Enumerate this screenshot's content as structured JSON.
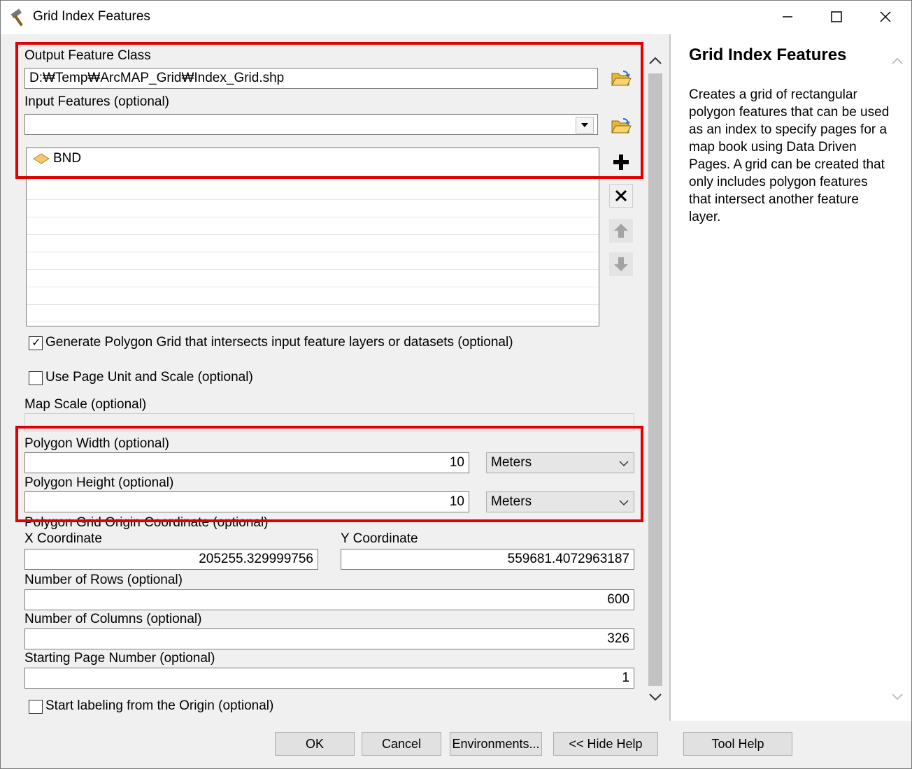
{
  "window": {
    "title": "Grid Index Features",
    "controls": [
      "minimize",
      "maximize",
      "close"
    ]
  },
  "form": {
    "output_feature_class": {
      "label": "Output Feature Class",
      "value": "D:₩Temp₩ArcMAP_Grid₩Index_Grid.shp"
    },
    "input_features": {
      "label": "Input Features (optional)",
      "value": "",
      "items": [
        "BND"
      ]
    },
    "generate_polygon_grid": {
      "label": "Generate Polygon Grid that intersects input feature layers or datasets (optional)",
      "checked": true
    },
    "use_page_unit": {
      "label": "Use Page Unit and Scale (optional)",
      "checked": false
    },
    "map_scale": {
      "label": "Map Scale (optional)",
      "value": ""
    },
    "polygon_width": {
      "label": "Polygon Width (optional)",
      "value": "10",
      "unit": "Meters"
    },
    "polygon_height": {
      "label": "Polygon Height (optional)",
      "value": "10",
      "unit": "Meters"
    },
    "origin": {
      "label": "Polygon Grid Origin Coordinate (optional)",
      "x_label": "X Coordinate",
      "x_value": "205255.329999756",
      "y_label": "Y Coordinate",
      "y_value": "559681.4072963187"
    },
    "rows": {
      "label": "Number of Rows (optional)",
      "value": "600"
    },
    "columns": {
      "label": "Number of Columns (optional)",
      "value": "326"
    },
    "starting_page": {
      "label": "Starting Page Number (optional)",
      "value": "1"
    },
    "start_labeling": {
      "label": "Start labeling from the Origin (optional)",
      "checked": false
    }
  },
  "buttons": {
    "ok": "OK",
    "cancel": "Cancel",
    "environments": "Environments...",
    "hide_help": "<< Hide Help",
    "tool_help": "Tool Help"
  },
  "help": {
    "title": "Grid Index Features",
    "body": "Creates a grid of rectangular polygon features that can be used as an index to specify pages for a map book using Data Driven Pages. A grid can be created that only includes polygon features that intersect another feature layer."
  },
  "colors": {
    "highlight_box": "#e00000",
    "dialog_bg": "#f0f0f0",
    "folder_icon": "#e8b53a"
  },
  "icons": [
    "hammer-icon",
    "open-folder-icon",
    "add-icon",
    "remove-icon",
    "move-up-icon",
    "move-down-icon",
    "chevron-down-icon",
    "scroll-up-icon",
    "scroll-down-icon",
    "polygon-layer-icon"
  ]
}
